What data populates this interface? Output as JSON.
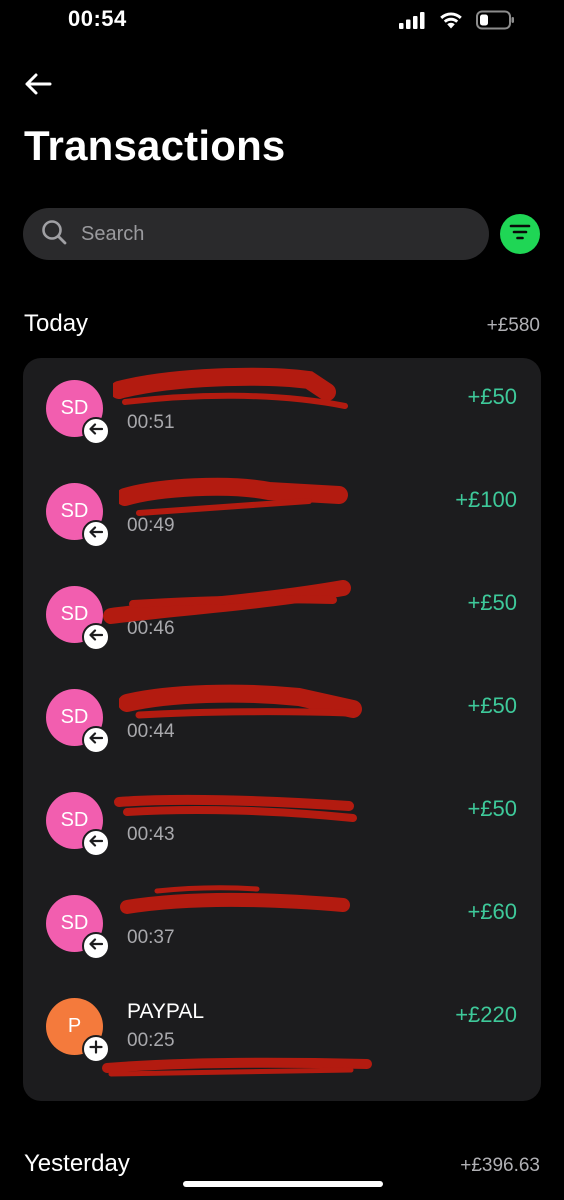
{
  "status_bar": {
    "time": "00:54"
  },
  "header": {
    "title": "Transactions"
  },
  "search": {
    "placeholder": "Search"
  },
  "colors": {
    "accent_green": "#1fd655",
    "amount_green": "#3ec99a",
    "avatar_pink": "#f25eaf",
    "avatar_orange": "#f47a3c"
  },
  "sections": [
    {
      "title": "Today",
      "total": "+£580",
      "transactions": [
        {
          "initials": "SD",
          "name": "",
          "time": "00:51",
          "amount": "+£50",
          "badge": "arrow-left-icon",
          "avatar_color": "#f25eaf"
        },
        {
          "initials": "SD",
          "name": "",
          "time": "00:49",
          "amount": "+£100",
          "badge": "arrow-left-icon",
          "avatar_color": "#f25eaf"
        },
        {
          "initials": "SD",
          "name": "",
          "time": "00:46",
          "amount": "+£50",
          "badge": "arrow-left-icon",
          "avatar_color": "#f25eaf"
        },
        {
          "initials": "SD",
          "name": "",
          "time": "00:44",
          "amount": "+£50",
          "badge": "arrow-left-icon",
          "avatar_color": "#f25eaf"
        },
        {
          "initials": "SD",
          "name": "",
          "time": "00:43",
          "amount": "+£50",
          "badge": "arrow-left-icon",
          "avatar_color": "#f25eaf"
        },
        {
          "initials": "SD",
          "name": "",
          "time": "00:37",
          "amount": "+£60",
          "badge": "arrow-left-icon",
          "avatar_color": "#f25eaf"
        },
        {
          "initials": "P",
          "name": "PAYPAL",
          "time": "00:25",
          "amount": "+£220",
          "badge": "plus-icon",
          "avatar_color": "#f47a3c"
        }
      ]
    },
    {
      "title": "Yesterday",
      "total": "+£396.63"
    }
  ]
}
